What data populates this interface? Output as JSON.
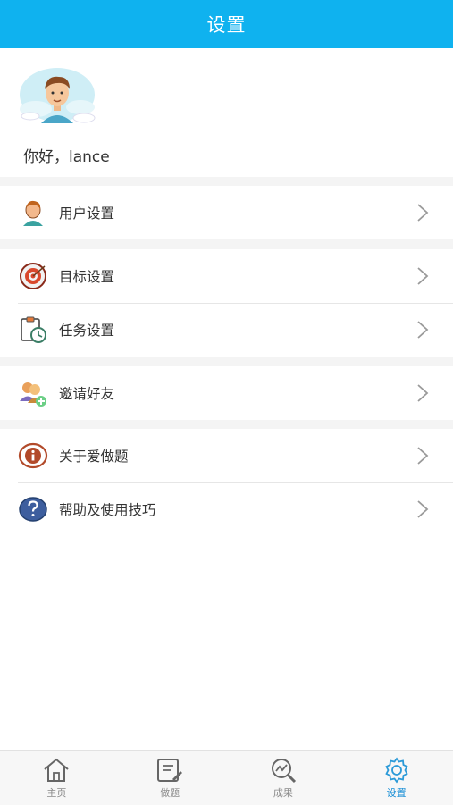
{
  "header": {
    "title": "设置"
  },
  "profile": {
    "greeting": "你好，lance"
  },
  "menu": {
    "user_settings": "用户设置",
    "goal_settings": "目标设置",
    "task_settings": "任务设置",
    "invite_friends": "邀请好友",
    "about": "关于爱做题",
    "help": "帮助及使用技巧"
  },
  "tabs": [
    {
      "label": "主页",
      "icon": "home-icon"
    },
    {
      "label": "做题",
      "icon": "edit-icon"
    },
    {
      "label": "成果",
      "icon": "results-icon"
    },
    {
      "label": "设置",
      "icon": "gear-icon"
    }
  ],
  "colors": {
    "accent": "#0fb2ef",
    "active_tab": "#1a8fd6"
  }
}
